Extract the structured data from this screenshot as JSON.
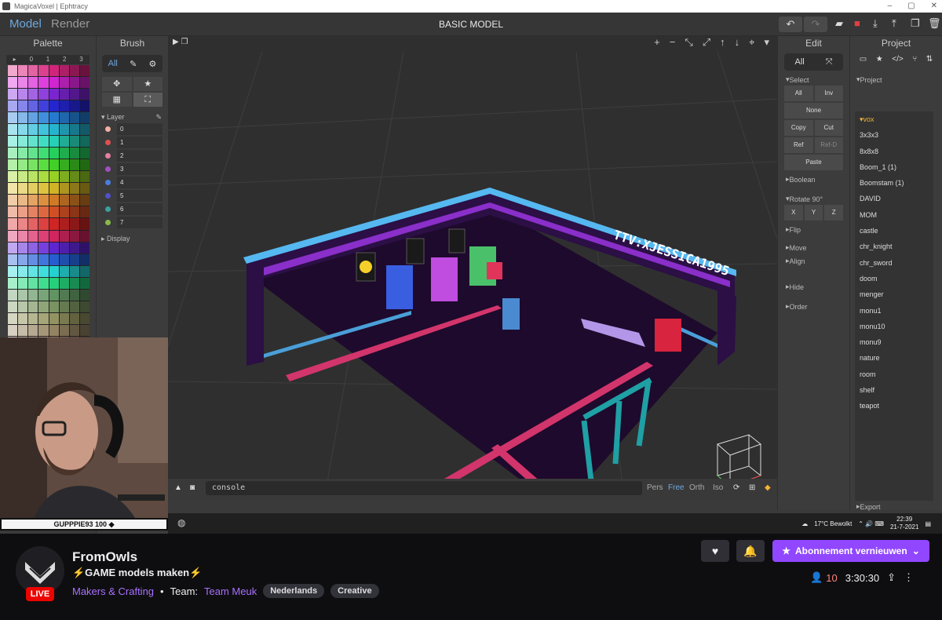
{
  "window": {
    "title": "MagicaVoxel | Ephtracy"
  },
  "app": {
    "modes": [
      "Model",
      "Render"
    ],
    "title": "BASIC MODEL",
    "palette": {
      "header": "Palette",
      "tabs": [
        "▸",
        "0",
        "1",
        "2",
        "3"
      ]
    },
    "brush": {
      "header": "Brush",
      "tab_all": "All",
      "layer_section": "Layer",
      "layers": [
        {
          "name": "0",
          "color": "#f2b1a0"
        },
        {
          "name": "1",
          "color": "#e05050"
        },
        {
          "name": "2",
          "color": "#e57fa0"
        },
        {
          "name": "3",
          "color": "#a050c0"
        },
        {
          "name": "4",
          "color": "#4a7ee0"
        },
        {
          "name": "5",
          "color": "#5050d0"
        },
        {
          "name": "6",
          "color": "#3aa0a0"
        },
        {
          "name": "7",
          "color": "#8aba4a"
        }
      ],
      "display_section": "Display"
    },
    "edit": {
      "header": "Edit",
      "tab_all": "All",
      "select_section": "Select",
      "buttons": {
        "all": "All",
        "inv": "Inv",
        "none": "None",
        "copy": "Copy",
        "cut": "Cut",
        "ref": "Ref",
        "refd": "Ref-D",
        "paste": "Paste"
      },
      "boolean_section": "Boolean",
      "rotate_section": "Rotate 90°",
      "axes": [
        "X",
        "Y",
        "Z"
      ],
      "flip_section": "Flip",
      "move_section": "Move",
      "align_section": "Align",
      "hide_section": "Hide",
      "order_section": "Order"
    },
    "project": {
      "header": "Project",
      "section": "Project",
      "items": [
        "vox",
        "3x3x3",
        "8x8x8",
        "Boom_1 (1)",
        "Boomstam (1)",
        "DAVID",
        "MOM",
        "castle",
        "chr_knight",
        "chr_sword",
        "doom",
        "menger",
        "monu1",
        "monu10",
        "monu9",
        "nature",
        "room",
        "shelf",
        "teapot"
      ],
      "export": "Export"
    },
    "viewport": {
      "console": "console",
      "camera_modes": [
        "Pers",
        "Free",
        "Orth",
        "Iso"
      ],
      "sign_text": "TTV:XJESSICA1995"
    }
  },
  "taskbar": {
    "weather": "17°C  Bewolkt",
    "time": "22:39",
    "date": "21-7-2021"
  },
  "webcam": {
    "sub_alert": "GUPPPIE93 100"
  },
  "stream": {
    "channel": "FromOwls",
    "title": "⚡GAME models maken⚡",
    "category": "Makers & Crafting",
    "team_label": "Team:",
    "team": "Team Meuk",
    "tags": [
      "Nederlands",
      "Creative"
    ],
    "live": "LIVE",
    "subscribe": "Abonnement vernieuwen",
    "viewers": "10",
    "uptime": "3:30:30",
    "accent": "#9147ff"
  }
}
